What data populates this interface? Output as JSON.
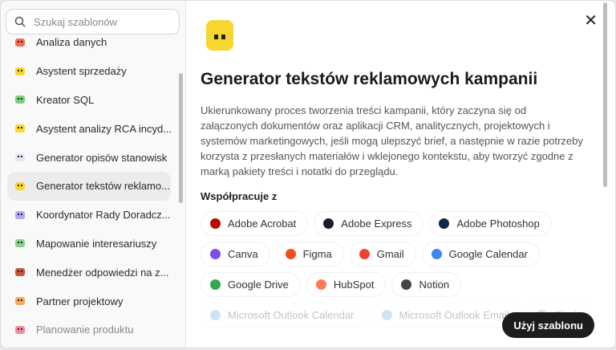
{
  "sidebar": {
    "search_placeholder": "Szukaj szablonów",
    "items": [
      {
        "label": "Analiza danych",
        "color": "#f06b5a"
      },
      {
        "label": "Asystent sprzedaży",
        "color": "#f8d631"
      },
      {
        "label": "Kreator SQL",
        "color": "#7ccf7a"
      },
      {
        "label": "Asystent analizy RCA incyd...",
        "color": "#f8d631"
      },
      {
        "label": "Generator opisów stanowisk",
        "color": "#e4e4f4"
      },
      {
        "label": "Generator tekstów reklamo...",
        "color": "#f8d631"
      },
      {
        "label": "Koordynator Rady Doradcz...",
        "color": "#b8a4f0"
      },
      {
        "label": "Mapowanie interesariuszy",
        "color": "#8ad08a"
      },
      {
        "label": "Menedżer odpowiedzi na z...",
        "color": "#c8553d"
      },
      {
        "label": "Partner projektowy",
        "color": "#f4a860"
      },
      {
        "label": "Planowanie produktu",
        "color": "#f48aa0"
      }
    ],
    "selected_index": 5
  },
  "main": {
    "title": "Generator tekstów reklamowych kampanii",
    "description": "Ukierunkowany proces tworzenia treści kampanii, który zaczyna się od załączonych dokumentów oraz aplikacji CRM, analitycznych, projektowych i systemów marketingowych, jeśli mogą ulepszyć brief, a następnie w razie potrzeby korzysta z przesłanych materiałów i wklejonego kontekstu, aby tworzyć zgodne z marką pakiety treści i notatki do przeglądu.",
    "works_with_label": "Współpracuje z",
    "integrations": [
      {
        "label": "Adobe Acrobat",
        "color": "#b30b00"
      },
      {
        "label": "Adobe Express",
        "color": "#1b1b2e"
      },
      {
        "label": "Adobe Photoshop",
        "color": "#0b2a4a"
      },
      {
        "label": "Canva",
        "color": "#7d4dea"
      },
      {
        "label": "Figma",
        "color": "#f24e1e"
      },
      {
        "label": "Gmail",
        "color": "#ea4335"
      },
      {
        "label": "Google Calendar",
        "color": "#4285f4"
      },
      {
        "label": "Google Drive",
        "color": "#34a853"
      },
      {
        "label": "HubSpot",
        "color": "#ff7a59"
      },
      {
        "label": "Notion",
        "color": "#444444"
      },
      {
        "label": "Microsoft Outlook Calendar",
        "color": "#cfe3f5"
      },
      {
        "label": "Microsoft Outlook Email",
        "color": "#cfe3f5"
      },
      {
        "label": "Slack",
        "color": "#e0e0e0"
      }
    ],
    "use_button": "Użyj szablonu",
    "close_icon": "close-icon"
  }
}
